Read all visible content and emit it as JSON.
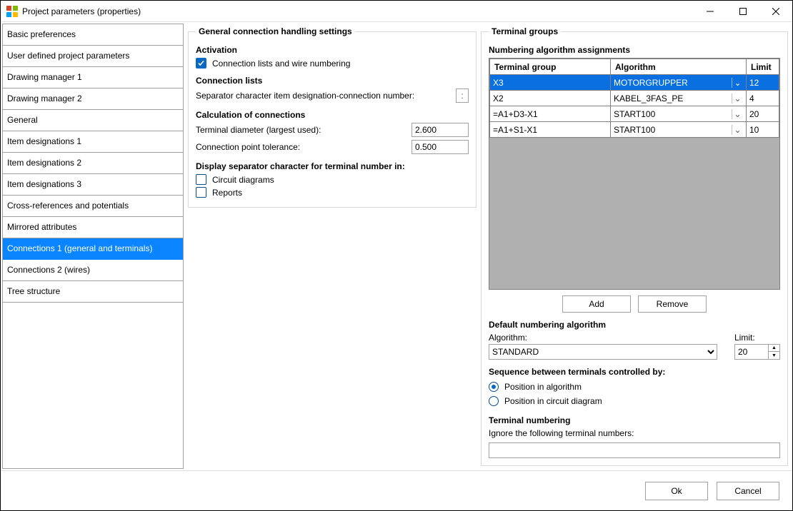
{
  "title": "Project parameters (properties)",
  "nav": {
    "items": [
      "Basic preferences",
      "User defined project parameters",
      "Drawing manager 1",
      "Drawing manager 2",
      "General",
      "Item designations 1",
      "Item designations 2",
      "Item designations 3",
      "Cross-references and potentials",
      "Mirrored attributes",
      "Connections 1 (general and terminals)",
      "Connections 2 (wires)",
      "Tree structure"
    ],
    "selected_index": 10
  },
  "left_panel": {
    "group_title": "General connection handling settings",
    "activation_head": "Activation",
    "activation_checkbox": "Connection lists and wire numbering",
    "activation_checked": true,
    "connection_lists_head": "Connection lists",
    "sep_label": "Separator character item designation-connection number:",
    "sep_value": ":",
    "calc_head": "Calculation of connections",
    "terminal_diam_label": "Terminal diameter (largest used):",
    "terminal_diam_value": "2.600",
    "conn_tol_label": "Connection point tolerance:",
    "conn_tol_value": "0.500",
    "disp_head": "Display separator character for terminal number in:",
    "disp_circuit_label": "Circuit diagrams",
    "disp_circuit_checked": false,
    "disp_reports_label": "Reports",
    "disp_reports_checked": false
  },
  "right_panel": {
    "group_title": "Terminal groups",
    "assign_head": "Numbering algorithm assignments",
    "cols": {
      "group": "Terminal group",
      "algo": "Algorithm",
      "limit": "Limit"
    },
    "rows": [
      {
        "group": "X3",
        "algo": "MOTORGRUPPER",
        "limit": "12",
        "selected": true
      },
      {
        "group": "X2",
        "algo": "KABEL_3FAS_PE",
        "limit": "4",
        "selected": false
      },
      {
        "group": "=A1+D3-X1",
        "algo": "START100",
        "limit": "20",
        "selected": false
      },
      {
        "group": "=A1+S1-X1",
        "algo": "START100",
        "limit": "10",
        "selected": false
      }
    ],
    "add_label": "Add",
    "remove_label": "Remove",
    "default_head": "Default numbering algorithm",
    "algo_label": "Algorithm:",
    "algo_value": "STANDARD",
    "limit_label": "Limit:",
    "limit_value": "20",
    "seq_head": "Sequence between terminals controlled by:",
    "seq_pos_algo": "Position in algorithm",
    "seq_pos_diagram": "Position in circuit diagram",
    "seq_selected": "algo",
    "tn_head": "Terminal numbering",
    "ignore_label": "Ignore the following terminal numbers:",
    "ignore_value": ""
  },
  "footer": {
    "ok": "Ok",
    "cancel": "Cancel"
  }
}
